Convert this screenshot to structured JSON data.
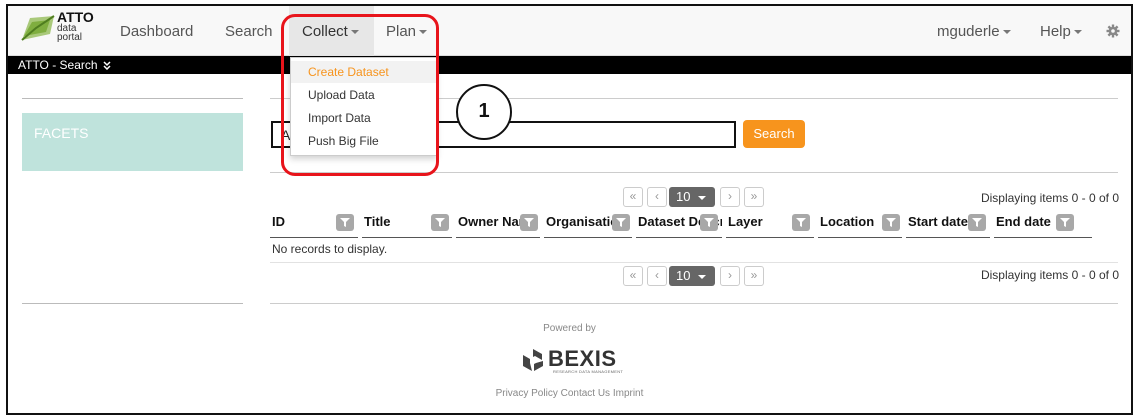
{
  "logo": {
    "title": "ATTO",
    "line2": "data",
    "line3": "portal"
  },
  "nav": {
    "items": [
      {
        "label": "Dashboard"
      },
      {
        "label": "Search"
      },
      {
        "label": "Collect"
      },
      {
        "label": "Plan"
      }
    ],
    "right": [
      {
        "label": "mguderle"
      },
      {
        "label": "Help"
      }
    ],
    "settings_icon": "gear-icon"
  },
  "breadcrumb_bar": {
    "label": "ATTO - Search",
    "icon": "double-chevron-down-icon"
  },
  "collect_menu": {
    "items": [
      {
        "label": "Create Dataset"
      },
      {
        "label": "Upload Data"
      },
      {
        "label": "Import Data"
      },
      {
        "label": "Push Big File"
      }
    ]
  },
  "callout": {
    "number": "1"
  },
  "sidebar": {
    "facets_label": "FACETS"
  },
  "search": {
    "value": "A",
    "button_label": "Search"
  },
  "pager": {
    "first": "«",
    "prev": "‹",
    "page_size": "10",
    "next": "›",
    "last": "»",
    "info": "Displaying items 0 - 0 of 0"
  },
  "table": {
    "columns": [
      "ID",
      "Title",
      "Owner Name",
      "Organisation",
      "Dataset Description",
      "Layer",
      "Location",
      "Start date",
      "End date"
    ],
    "empty_message": "No records to display."
  },
  "footer": {
    "powered_by": "Powered by",
    "brand": "BEXIS",
    "brand_sub": "RESEARCH DATA MANAGEMENT",
    "links": "Privacy Policy Contact Us Imprint"
  },
  "colors": {
    "accent": "#f7941d",
    "facets_bg": "#bfe3dc",
    "highlight": "#e8141b"
  }
}
